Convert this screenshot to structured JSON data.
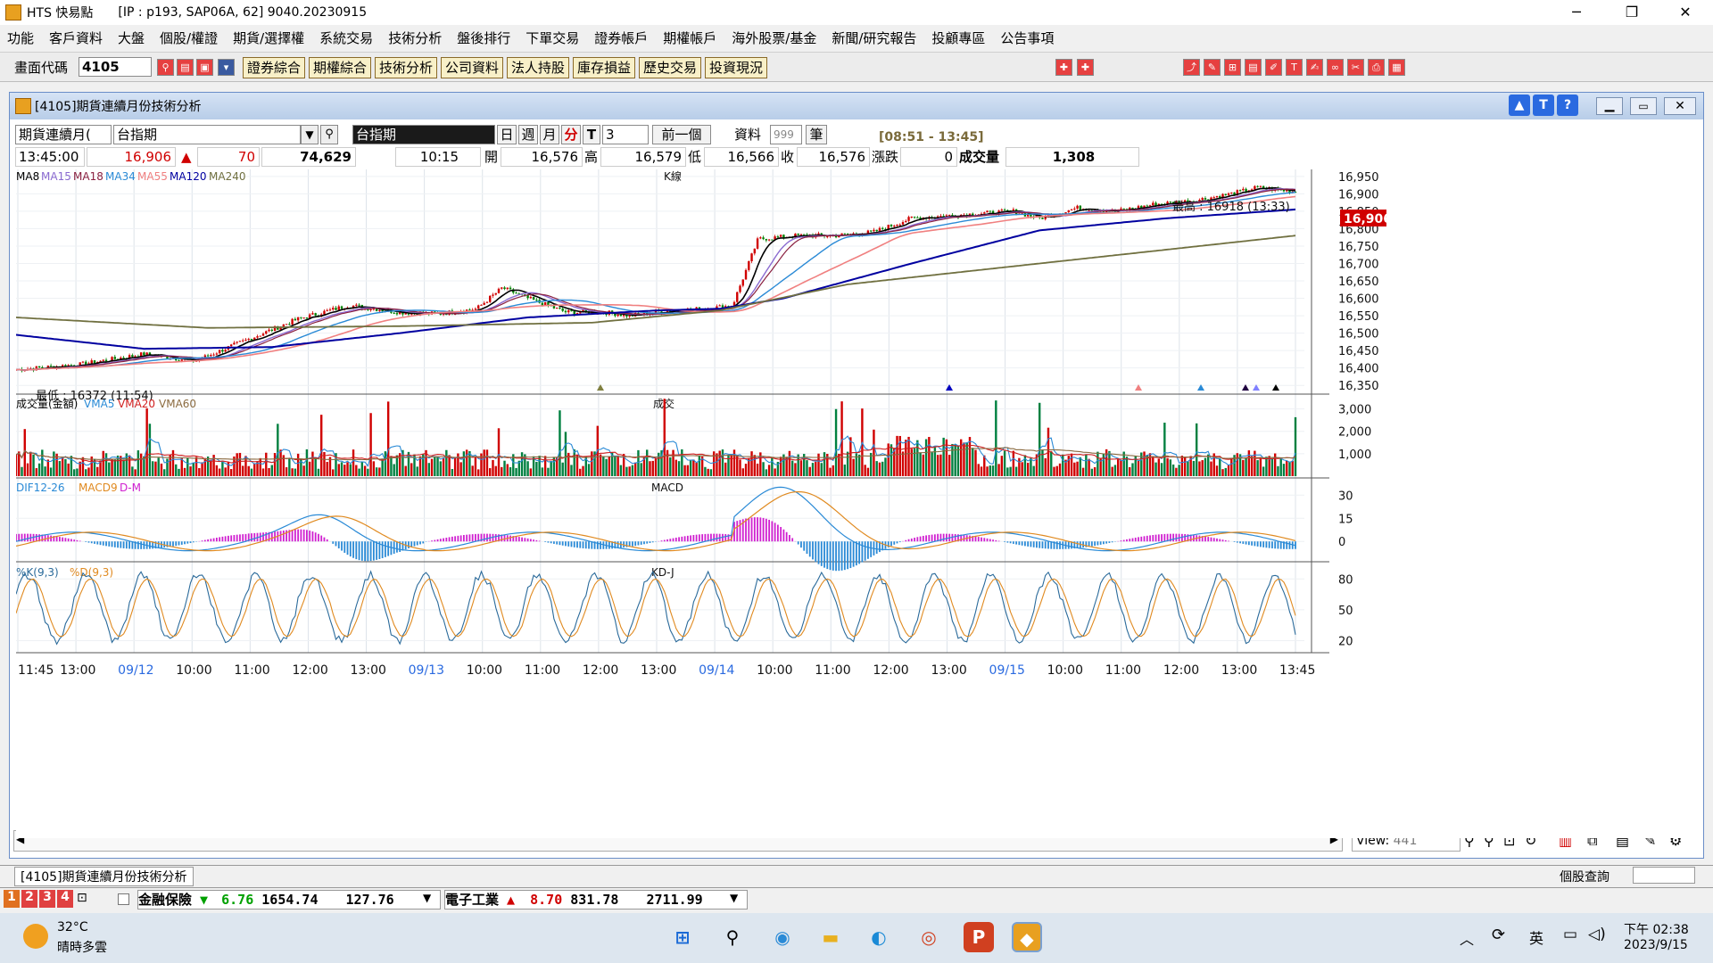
{
  "window": {
    "title": "HTS 快易點",
    "server_info": "[IP : p193, SAP06A, 62] 9040.20230915",
    "minimize": "─",
    "maximize": "❐",
    "close": "✕"
  },
  "menu": [
    "功能",
    "客戶資料",
    "大盤",
    "個股/權證",
    "期貨/選擇權",
    "系統交易",
    "技術分析",
    "盤後排行",
    "下單交易",
    "證券帳戶",
    "期權帳戶",
    "海外股票/基金",
    "新聞/研究報告",
    "投顧專區",
    "公告事項"
  ],
  "toolbar": {
    "code_label": "畫面代碼",
    "code_value": "4105",
    "buttons": [
      "證券綜合",
      "期權綜合",
      "技術分析",
      "公司資料",
      "法人持股",
      "庫存損益",
      "歷史交易",
      "投資現況"
    ]
  },
  "subwindow": {
    "title": "[4105]期貨連續月份技術分析",
    "controls": {
      "product_type": "期貨連續月(",
      "product_name": "台指期",
      "selected_name": "台指期",
      "periods": [
        "日",
        "週",
        "月",
        "分",
        "T"
      ],
      "interval": "3",
      "prev_button": "前一個",
      "data_label": "資料",
      "data_count": "999",
      "chart_type": "筆",
      "time_range": "[08:51 - 13:45]"
    },
    "quote": {
      "time": "13:45:00",
      "price": "16,906",
      "change": "70",
      "volume_total": "74,629",
      "trade_time": "10:15",
      "open_label": "開",
      "open": "16,576",
      "high_label": "高",
      "high": "16,579",
      "low_label": "低",
      "low": "16,566",
      "close_label": "收",
      "close": "16,576",
      "chg_label": "漲跌",
      "chg": "0",
      "vol_label": "成交量",
      "vol": "1,308"
    }
  },
  "chart_data": [
    {
      "type": "line",
      "title": "K線",
      "legend": [
        "MA8",
        "MA15",
        "MA18",
        "MA34",
        "MA55",
        "MA120",
        "MA240"
      ],
      "colors": {
        "MA8": "#000000",
        "MA15": "#8a6ad0",
        "MA18": "#8a2040",
        "MA34": "#2a8ad6",
        "MA55": "#f08080",
        "MA120": "#0000a0",
        "MA240": "#707040"
      },
      "ylim": [
        16330,
        16970
      ],
      "yticks": [
        16350,
        16400,
        16450,
        16500,
        16550,
        16600,
        16650,
        16700,
        16750,
        16800,
        16850,
        16900,
        16950
      ],
      "high_label": "最高 : 16918 (13:33)",
      "low_label": "最低 : 16372 (11:54)",
      "last_price": "16,906",
      "price_path": [
        [
          0,
          16395
        ],
        [
          5,
          16410
        ],
        [
          10,
          16440
        ],
        [
          14,
          16420
        ],
        [
          18,
          16480
        ],
        [
          22,
          16540
        ],
        [
          26,
          16580
        ],
        [
          30,
          16560
        ],
        [
          33,
          16555
        ],
        [
          36,
          16570
        ],
        [
          38,
          16630
        ],
        [
          40,
          16600
        ],
        [
          43,
          16560
        ],
        [
          46,
          16560
        ],
        [
          48,
          16550
        ],
        [
          51,
          16565
        ],
        [
          54,
          16570
        ],
        [
          56,
          16580
        ],
        [
          58,
          16770
        ],
        [
          61,
          16780
        ],
        [
          64,
          16780
        ],
        [
          67,
          16790
        ],
        [
          70,
          16830
        ],
        [
          74,
          16840
        ],
        [
          78,
          16850
        ],
        [
          80,
          16830
        ],
        [
          83,
          16860
        ],
        [
          86,
          16850
        ],
        [
          89,
          16870
        ],
        [
          92,
          16880
        ],
        [
          95,
          16900
        ],
        [
          97,
          16918
        ],
        [
          100,
          16906
        ]
      ],
      "ma120_path": [
        [
          0,
          16495
        ],
        [
          10,
          16455
        ],
        [
          20,
          16460
        ],
        [
          30,
          16500
        ],
        [
          40,
          16545
        ],
        [
          50,
          16565
        ],
        [
          55,
          16570
        ],
        [
          60,
          16600
        ],
        [
          70,
          16700
        ],
        [
          80,
          16795
        ],
        [
          90,
          16830
        ],
        [
          100,
          16855
        ]
      ],
      "ma240_path": [
        [
          0,
          16545
        ],
        [
          15,
          16515
        ],
        [
          30,
          16520
        ],
        [
          45,
          16530
        ],
        [
          55,
          16565
        ],
        [
          65,
          16640
        ],
        [
          80,
          16700
        ],
        [
          90,
          16740
        ],
        [
          100,
          16780
        ]
      ]
    },
    {
      "type": "bar",
      "title": "成交",
      "legend": [
        "成交量(金額)",
        "VMA5",
        "VMA20",
        "VMA60"
      ],
      "colors": {
        "成交量(金額)": "#000000",
        "VMA5": "#2a8ad6",
        "VMA20": "#d02020",
        "VMA60": "#8a6a40"
      },
      "ylim": [
        0,
        3500
      ],
      "yticks": [
        1000,
        2000,
        3000
      ]
    },
    {
      "type": "line",
      "title": "MACD",
      "legend": [
        "DIF12-26",
        "MACD9",
        "D-M"
      ],
      "colors": {
        "DIF12-26": "#2a8ad6",
        "MACD9": "#e08a20",
        "D-M": "#d020d0"
      },
      "ylim": [
        -12,
        40
      ],
      "yticks": [
        0,
        15,
        30
      ]
    },
    {
      "type": "line",
      "title": "KD-J",
      "legend": [
        "%K(9,3)",
        "%D(9,3)"
      ],
      "colors": {
        "%K(9,3)": "#2a6a9a",
        "%D(9,3)": "#e08a20"
      },
      "ylim": [
        10,
        95
      ],
      "yticks": [
        20,
        50,
        80
      ]
    }
  ],
  "xaxis": {
    "ticks": [
      "11:45",
      "13:00",
      "09/12",
      "10:00",
      "11:00",
      "12:00",
      "13:00",
      "09/13",
      "10:00",
      "11:00",
      "12:00",
      "13:00",
      "09/14",
      "10:00",
      "11:00",
      "12:00",
      "13:00",
      "09/15",
      "10:00",
      "11:00",
      "12:00",
      "13:00",
      "13:45"
    ],
    "date_ticks": [
      "09/12",
      "09/13",
      "09/14",
      "09/15"
    ]
  },
  "statusbar": {
    "view_label": "View:",
    "view_value": "441"
  },
  "bottom": {
    "tab": "[4105]期貨連續月份技術分析",
    "right_label": "個股查詢",
    "quote1_name": "金融保險",
    "quote1_chg": "6.76",
    "quote1_price": "1654.74",
    "quote1_vol": "127.76",
    "quote2_name": "電子工業",
    "quote2_chg": "8.70",
    "quote2_price": "831.78",
    "quote2_vol": "2711.99",
    "pages": [
      "1",
      "2",
      "3",
      "4"
    ]
  },
  "taskbar": {
    "weather_temp": "32°C",
    "weather_desc": "晴時多雲",
    "time": "下午 02:38",
    "date": "2023/9/15",
    "ime": "英"
  }
}
